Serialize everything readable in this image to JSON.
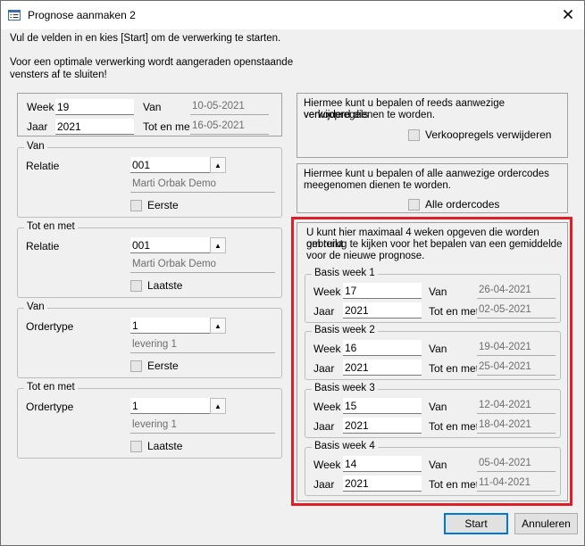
{
  "window": {
    "title": "Prognose aanmaken 2",
    "app_icon": "form-list-icon",
    "close_icon": "close-icon"
  },
  "intro": {
    "line1": "Vul de velden in en kies [Start] om de verwerking te starten.",
    "line2a": "Voor een optimale verwerking wordt aangeraden openstaande",
    "line2b": "vensters af te sluiten!"
  },
  "period": {
    "week_label": "Week",
    "week_value": "19",
    "jaar_label": "Jaar",
    "jaar_value": "2021",
    "van_label": "Van",
    "van_value": "10-05-2021",
    "tot_label": "Tot en met",
    "tot_value": "16-05-2021"
  },
  "relatie_van": {
    "legend": "Van",
    "label": "Relatie",
    "value": "001",
    "name": "Marti Orbak Demo",
    "checkbox_label": "Eerste",
    "checked": false
  },
  "relatie_tot": {
    "legend": "Tot en met",
    "label": "Relatie",
    "value": "001",
    "name": "Marti Orbak Demo",
    "checkbox_label": "Laatste",
    "checked": false
  },
  "ordertype_van": {
    "legend": "Van",
    "label": "Ordertype",
    "value": "1",
    "name": "levering 1",
    "checkbox_label": "Eerste",
    "checked": false
  },
  "ordertype_tot": {
    "legend": "Tot en met",
    "label": "Ordertype",
    "value": "1",
    "name": "levering 1",
    "checkbox_label": "Laatste",
    "checked": false
  },
  "verkoopregels": {
    "text1": "Hiermee kunt u bepalen of reeds aanwezige verkoopregels",
    "text2": "verwijderd dienen te worden.",
    "checkbox_label": "Verkoopregels verwijderen",
    "checked": false
  },
  "ordercodes": {
    "text1": "Hiermee kunt u bepalen of alle aanwezige ordercodes",
    "text2": "meegenomen dienen te worden.",
    "checkbox_label": "Alle ordercodes",
    "checked": false
  },
  "basis": {
    "text1": "U kunt hier maximaal 4 weken opgeven die worden gebruikt",
    "text2": "om terug te kijken voor het bepalen van een gemiddelde",
    "text3": "voor de nieuwe prognose.",
    "week_label": "Week",
    "jaar_label": "Jaar",
    "van_label": "Van",
    "tot_label": "Tot en met",
    "weeks": [
      {
        "legend": "Basis week 1",
        "week": "17",
        "jaar": "2021",
        "van": "26-04-2021",
        "tot": "02-05-2021"
      },
      {
        "legend": "Basis week 2",
        "week": "16",
        "jaar": "2021",
        "van": "19-04-2021",
        "tot": "25-04-2021"
      },
      {
        "legend": "Basis week 3",
        "week": "15",
        "jaar": "2021",
        "van": "12-04-2021",
        "tot": "18-04-2021"
      },
      {
        "legend": "Basis week 4",
        "week": "14",
        "jaar": "2021",
        "van": "05-04-2021",
        "tot": "11-04-2021"
      }
    ]
  },
  "buttons": {
    "start": "Start",
    "cancel": "Annuleren"
  },
  "colors": {
    "highlight": "#e01e26",
    "primary_border": "#0078d7"
  }
}
